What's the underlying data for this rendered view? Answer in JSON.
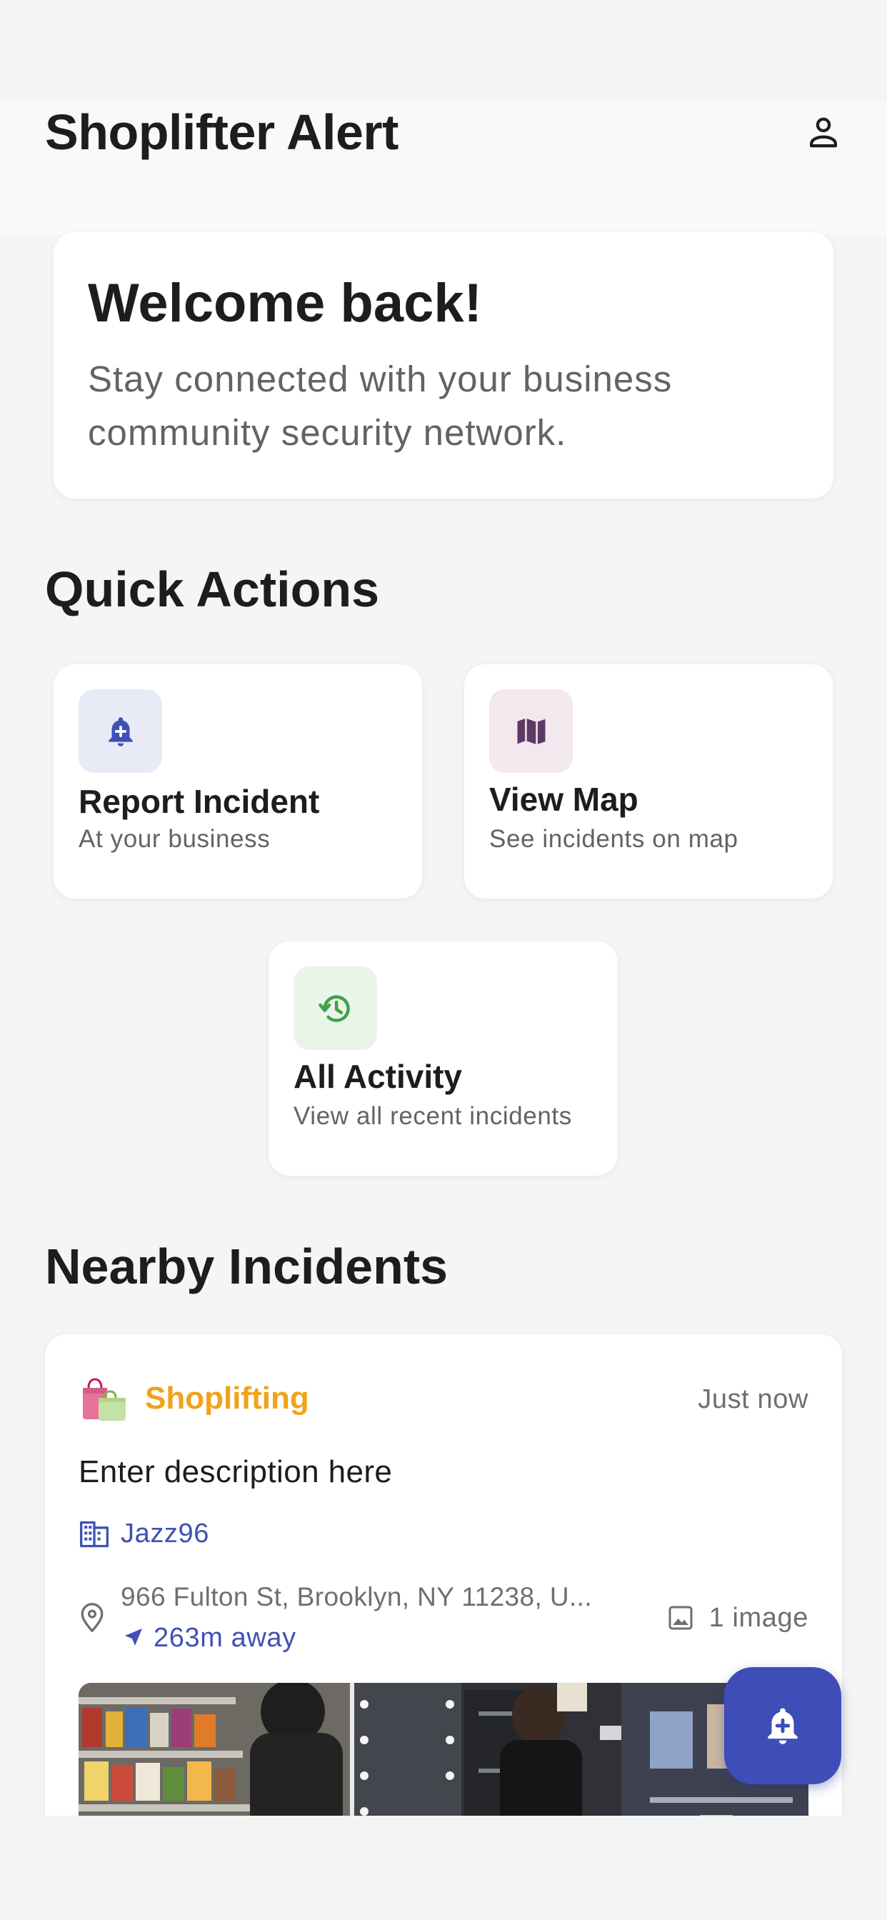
{
  "app": {
    "title": "Shoplifter Alert",
    "accent_color": "#3f4db8",
    "profile_icon": "person-outline-icon"
  },
  "welcome": {
    "title": "Welcome back!",
    "subtitle": "Stay connected with your business community security network."
  },
  "quick_actions": {
    "heading": "Quick Actions",
    "items": [
      {
        "title": "Report Incident",
        "subtitle": "At your business",
        "icon": "add-alert-icon",
        "icon_bg": "#e8eaf6",
        "icon_color": "#3f51b5"
      },
      {
        "title": "View Map",
        "subtitle": "See incidents on map",
        "icon": "map-icon",
        "icon_bg": "#f3e8ee",
        "icon_color": "#5d3a66"
      },
      {
        "title": "All Activity",
        "subtitle": "View all recent incidents",
        "icon": "history-icon",
        "icon_bg": "#e8f5e9",
        "icon_color": "#43a047"
      }
    ]
  },
  "nearby": {
    "heading": "Nearby Incidents",
    "incidents": [
      {
        "type": "Shoplifting",
        "type_icon": "shopping-bags-icon",
        "type_color": "#f0a21a",
        "time": "Just now",
        "description": "Enter description here",
        "business": "Jazz96",
        "address": "966 Fulton St, Brooklyn, NY 11238, U...",
        "distance": "263m away",
        "image_count": "1 image"
      }
    ]
  },
  "fab": {
    "icon": "add-alert-icon"
  }
}
